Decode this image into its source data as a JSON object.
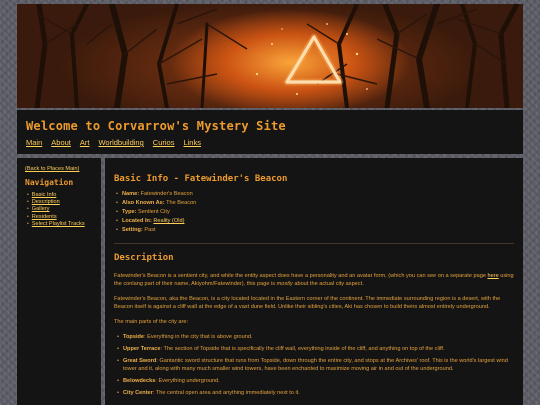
{
  "site": {
    "title": "Welcome to Corvarrow's Mystery Site",
    "nav": [
      "Main",
      "About",
      "Art",
      "Worldbuilding",
      "Curios",
      "Links"
    ]
  },
  "sidebar": {
    "back_link": "(Back to Places Main)",
    "heading": "Navigation",
    "items": [
      "Basic Info",
      "Description",
      "Gallery",
      "Residents",
      "Select Playlist Tracks"
    ]
  },
  "main": {
    "heading": "Basic Info - Fatewinder's Beacon",
    "info": [
      {
        "label": "Name:",
        "value": "Fatewinder's Beacon"
      },
      {
        "label": "Also Known As:",
        "value": "The Beacon"
      },
      {
        "label": "Type:",
        "value": "Sentient City"
      },
      {
        "label": "Located In:",
        "value": "Reality (Old)"
      },
      {
        "label": "Setting:",
        "value": "Past"
      }
    ],
    "description_heading": "Description",
    "p1_a": "Fatewinder's Beacon is a sentient city, and while the entity aspect does have a personality and an avatar form, (which you can see on a separate page ",
    "p1_link": "here",
    "p1_b": " using the conlang part of their name, Akiyohm/Fatewinder), this page is ",
    "p1_em": "mostly",
    "p1_c": " about the actual city aspect.",
    "p2": "Fatewinder's Beacon, aka the Beacon, is a city located located in the Eastern corner of the continent. The immediate surrounding region is a desert, with the Beacon itself is against a cliff wall at the edge of a vast dune field. Unlike their sibling's cities, Aki has chosen to build theirs almost entirely underground.",
    "p3": "The main parts of the city are:",
    "parts": [
      {
        "label": "Topside",
        "text": ": Everything in the city that is above ground."
      },
      {
        "label": "Upper Terrace",
        "text": ": The section of Topside that is specifically the cliff wall, everything inside of the cliff, and anything on top of the cliff."
      },
      {
        "label": "Great Sword",
        "text": ": Gantantic sword structure that runs from Topside, down through the entire city, and stops at the Archives' roof. This is the world's largest wind tower and it, along with many much smaller wind towers, have been enchanted to maximize moving air in and out of the underground."
      },
      {
        "label": "Belowdecks",
        "text": ": Everything underground."
      },
      {
        "label": "City Center",
        "text": ": The central open area and anything immediately next to it."
      }
    ]
  },
  "colors": {
    "panel": "#141414",
    "heading": "#ee9b2e",
    "text": "#e6a23c",
    "link": "#ffcf5a"
  }
}
